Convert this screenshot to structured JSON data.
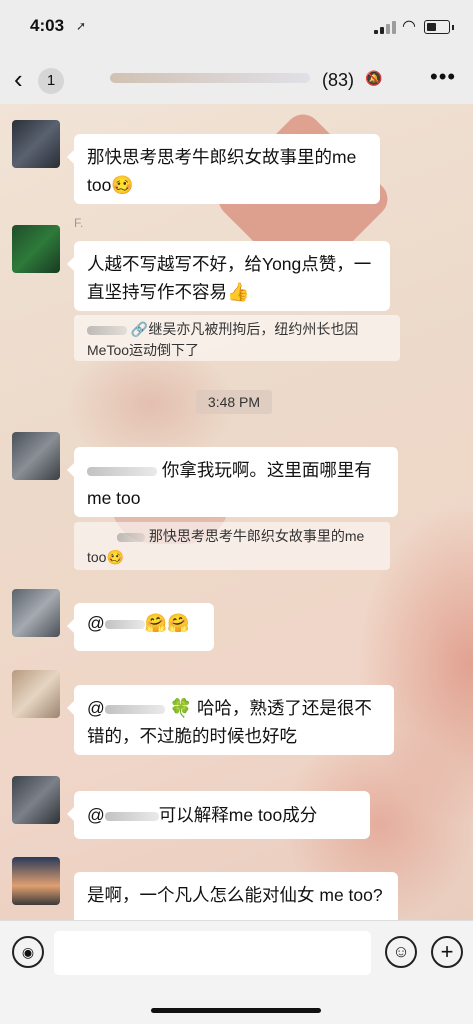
{
  "status_bar": {
    "time": "4:03",
    "location_icon": "location-arrow-icon"
  },
  "header": {
    "back_icon": "chevron-left-icon",
    "unread_badge": "1",
    "member_count": "(83)",
    "mute_icon": "bell-slash-icon",
    "more_icon": "more-icon"
  },
  "messages": [
    {
      "text": "那快思考思考牛郎织女故事里的me too",
      "emoji": "🥴"
    },
    {
      "sender": "F.",
      "text": "人越不写越写不好，给Yong点赞，一直坚持写作不容易",
      "emoji": "👍",
      "quote": "继吴亦凡被刑拘后，纽约州长也因MeToo运动倒下了"
    },
    {
      "timestamp": "3:48 PM"
    },
    {
      "text": "你拿我玩啊。这里面哪里有 me too",
      "quote": "那快思考思考牛郎织女故事里的me too",
      "quote_emoji": "🥴"
    },
    {
      "text": "@",
      "emoji": "🤗🤗"
    },
    {
      "text_prefix": "@",
      "emoji": "🍀",
      "text": "哈哈，熟透了还是很不错的，不过脆的时候也好吃"
    },
    {
      "text_prefix": "@",
      "text": "可以解释me too成分"
    },
    {
      "text": "是啊，一个凡人怎么能对仙女 me too?"
    }
  ],
  "input_bar": {
    "voice_icon": "voice-icon",
    "emoji_icon": "smiley-icon",
    "plus_icon": "plus-icon"
  },
  "colors": {
    "bubble": "#ffffff",
    "bar": "#ededed",
    "accent_wallpaper": "#d6786a"
  }
}
